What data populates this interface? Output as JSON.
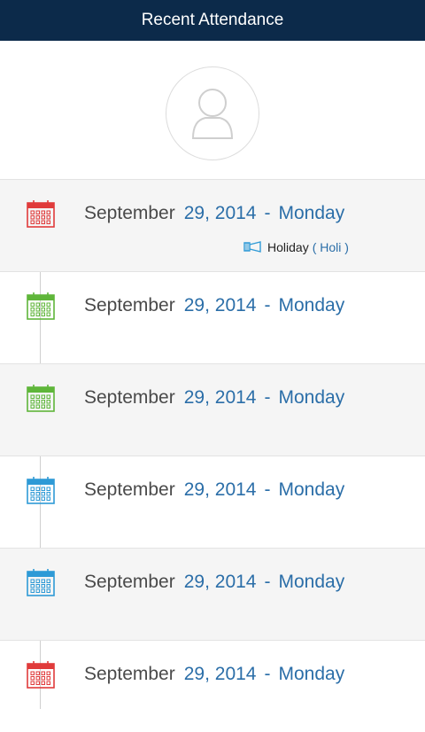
{
  "header": {
    "title": "Recent Attendance"
  },
  "icons": {
    "avatar": "user-placeholder-icon",
    "calendar": "calendar-icon",
    "holiday": "holiday-icon"
  },
  "colors": {
    "header_bg": "#0c2a4a",
    "accent_text": "#2b6ea8",
    "cal_red": "#e03b3b",
    "cal_green": "#5fb63a",
    "cal_blue": "#2e9ad6"
  },
  "rows": [
    {
      "month": "September",
      "day": "29, 2014",
      "dash": "-",
      "weekday": "Monday",
      "status": "red",
      "note": {
        "label": "Holiday",
        "detail": "( Holi )"
      }
    },
    {
      "month": "September",
      "day": "29, 2014",
      "dash": "-",
      "weekday": "Monday",
      "status": "green"
    },
    {
      "month": "September",
      "day": "29, 2014",
      "dash": "-",
      "weekday": "Monday",
      "status": "green"
    },
    {
      "month": "September",
      "day": "29, 2014",
      "dash": "-",
      "weekday": "Monday",
      "status": "blue"
    },
    {
      "month": "September",
      "day": "29, 2014",
      "dash": "-",
      "weekday": "Monday",
      "status": "blue"
    },
    {
      "month": "September",
      "day": "29, 2014",
      "dash": "-",
      "weekday": "Monday",
      "status": "red"
    }
  ]
}
